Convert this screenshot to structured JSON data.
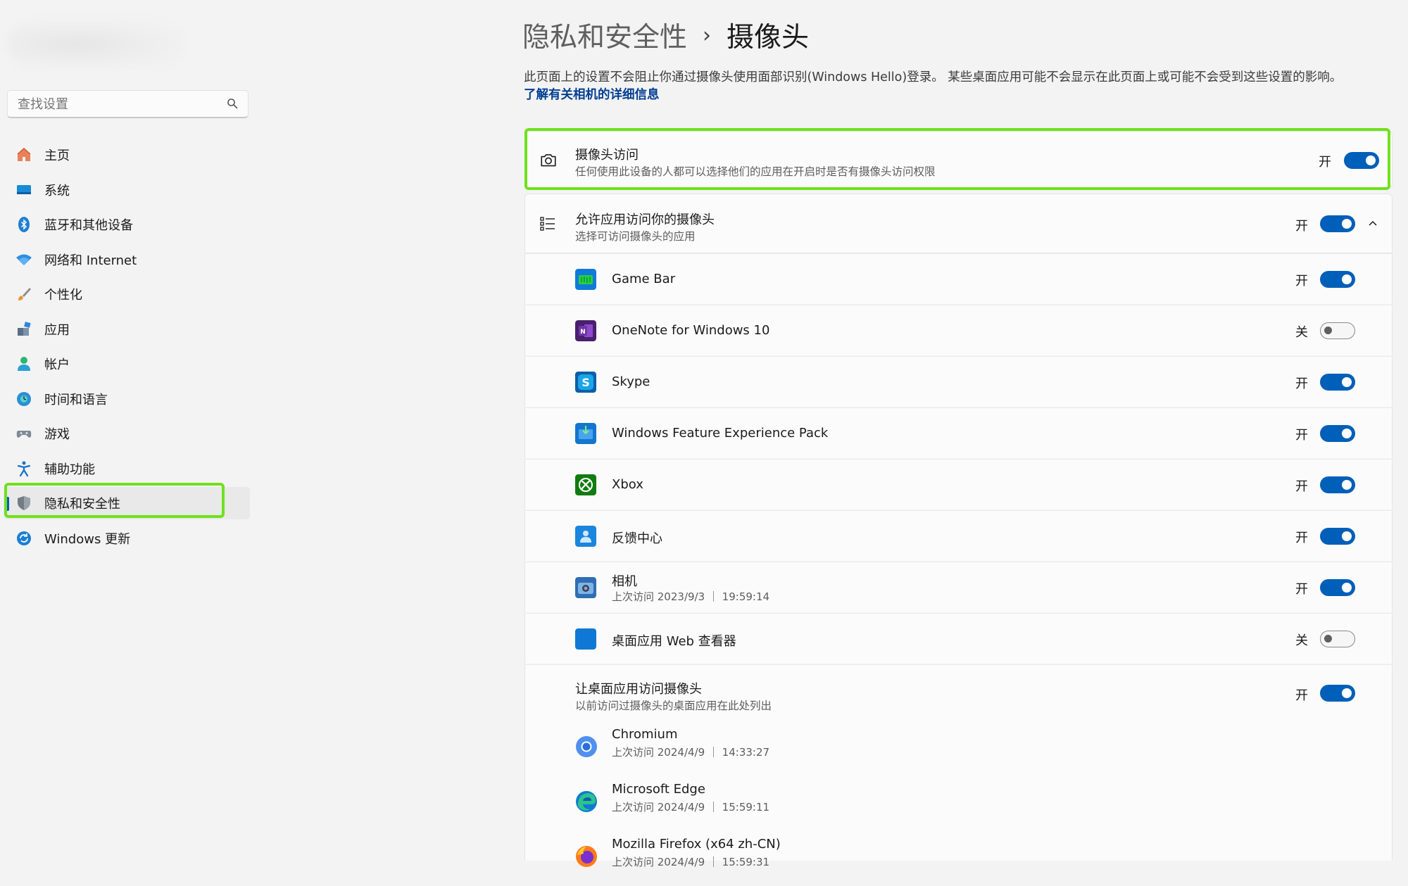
{
  "sidebar": {
    "search_placeholder": "查找设置",
    "items": [
      {
        "label": "主页",
        "icon": "home-icon"
      },
      {
        "label": "系统",
        "icon": "system-icon"
      },
      {
        "label": "蓝牙和其他设备",
        "icon": "bluetooth-icon"
      },
      {
        "label": "网络和 Internet",
        "icon": "wifi-icon"
      },
      {
        "label": "个性化",
        "icon": "brush-icon"
      },
      {
        "label": "应用",
        "icon": "apps-icon"
      },
      {
        "label": "帐户",
        "icon": "account-icon"
      },
      {
        "label": "时间和语言",
        "icon": "globe-icon"
      },
      {
        "label": "游戏",
        "icon": "gamepad-icon"
      },
      {
        "label": "辅助功能",
        "icon": "accessibility-icon"
      },
      {
        "label": "隐私和安全性",
        "icon": "shield-icon",
        "active": true
      },
      {
        "label": "Windows 更新",
        "icon": "update-icon"
      }
    ]
  },
  "breadcrumb": {
    "parent": "隐私和安全性",
    "separator": "›",
    "current": "摄像头"
  },
  "description": "此页面上的设置不会阻止你通过摄像头使用面部识别(Windows Hello)登录。 某些桌面应用可能不会显示在此页面上或可能不会受到这些设置的影响。",
  "learn_more": "了解有关相机的详细信息",
  "camera_access": {
    "title": "摄像头访问",
    "subtitle": "任何使用此设备的人都可以选择他们的应用在开启时是否有摄像头访问权限",
    "state": "开",
    "on": true
  },
  "app_access": {
    "title": "允许应用访问你的摄像头",
    "subtitle": "选择可访问摄像头的应用",
    "state": "开",
    "on": true
  },
  "apps": [
    {
      "name": "Game Bar",
      "state": "开",
      "on": true,
      "icon": "gamebar-icon"
    },
    {
      "name": "OneNote for Windows 10",
      "state": "关",
      "on": false,
      "icon": "onenote-icon"
    },
    {
      "name": "Skype",
      "state": "开",
      "on": true,
      "icon": "skype-icon"
    },
    {
      "name": "Windows Feature Experience Pack",
      "state": "开",
      "on": true,
      "icon": "feature-pack-icon"
    },
    {
      "name": "Xbox",
      "state": "开",
      "on": true,
      "icon": "xbox-icon"
    },
    {
      "name": "反馈中心",
      "state": "开",
      "on": true,
      "icon": "feedback-hub-icon"
    },
    {
      "name": "相机",
      "sub": "上次访问 2023/9/3 ｜ 19:59:14",
      "state": "开",
      "on": true,
      "icon": "camera-app-icon"
    },
    {
      "name": "桌面应用 Web 查看器",
      "state": "关",
      "on": false,
      "icon": "web-viewer-icon"
    }
  ],
  "desktop_access": {
    "title": "让桌面应用访问摄像头",
    "subtitle": "以前访问过摄像头的桌面应用在此处列出",
    "state": "开",
    "on": true
  },
  "desktop_apps": [
    {
      "name": "Chromium",
      "sub": "上次访问 2024/4/9 ｜ 14:33:27",
      "icon": "chromium-icon"
    },
    {
      "name": "Microsoft Edge",
      "sub": "上次访问 2024/4/9 ｜ 15:59:11",
      "icon": "edge-icon"
    },
    {
      "name": "Mozilla Firefox (x64 zh-CN)",
      "sub": "上次访问 2024/4/9 ｜ 15:59:31",
      "icon": "firefox-icon"
    }
  ],
  "colors": {
    "accent": "#005fb8",
    "highlight": "#6fe11c",
    "link": "#003e92"
  }
}
